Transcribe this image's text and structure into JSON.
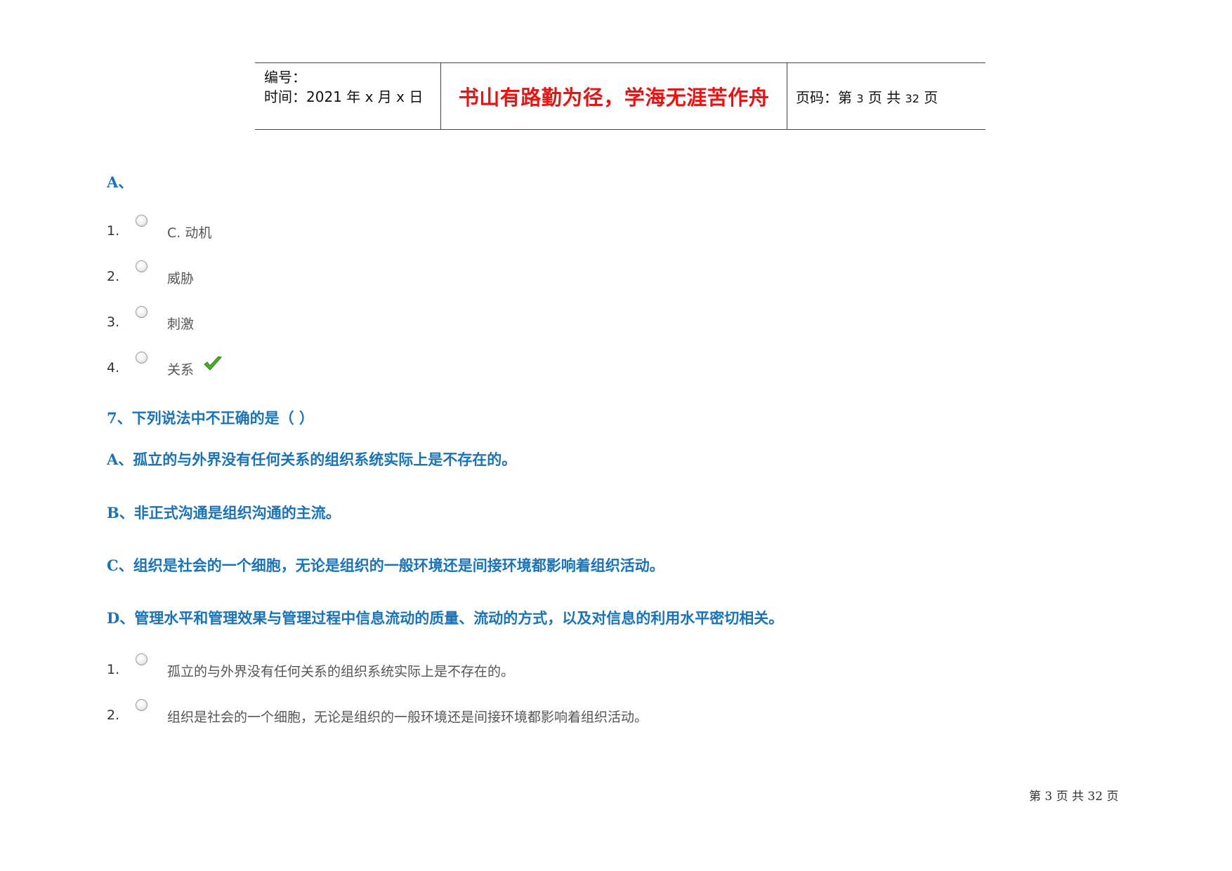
{
  "header": {
    "number_label": "编号：",
    "time_label": "时间：2021 年 x 月 x 日",
    "motto": "书山有路勤为径，学海无涯苦作舟",
    "page_code_prefix": "页码：第",
    "page_current": "3",
    "page_mid": "页  共",
    "page_total": "32",
    "page_suffix": "页"
  },
  "q6": {
    "heading": "A、",
    "options": [
      {
        "num": "1.",
        "text": "C.  动机",
        "correct": false
      },
      {
        "num": "2.",
        "text": "威胁",
        "correct": false
      },
      {
        "num": "3.",
        "text": "刺激",
        "correct": false
      },
      {
        "num": "4.",
        "text": "关系",
        "correct": true
      }
    ],
    "check_icon": "checkmark-icon"
  },
  "q7": {
    "question": "7、下列说法中不正确的是（    ）",
    "choices": [
      "A、孤立的与外界没有任何关系的组织系统实际上是不存在的。",
      "B、非正式沟通是组织沟通的主流。",
      "C、组织是社会的一个细胞，无论是组织的一般环境还是间接环境都影响着组织活动。",
      "D、管理水平和管理效果与管理过程中信息流动的质量、流动的方式，以及对信息的利用水平密切相关。"
    ],
    "options": [
      {
        "num": "1.",
        "text": "孤立的与外界没有任何关系的组织系统实际上是不存在的。"
      },
      {
        "num": "2.",
        "text": "组织是社会的一个细胞，无论是组织的一般环境还是间接环境都影响着组织活动。"
      }
    ]
  },
  "footer": {
    "page_label": "第 3 页 共 32 页"
  },
  "colors": {
    "heading_blue": "#1a73b8",
    "motto_red": "#ee1111",
    "check_green": "#4caf2a"
  }
}
